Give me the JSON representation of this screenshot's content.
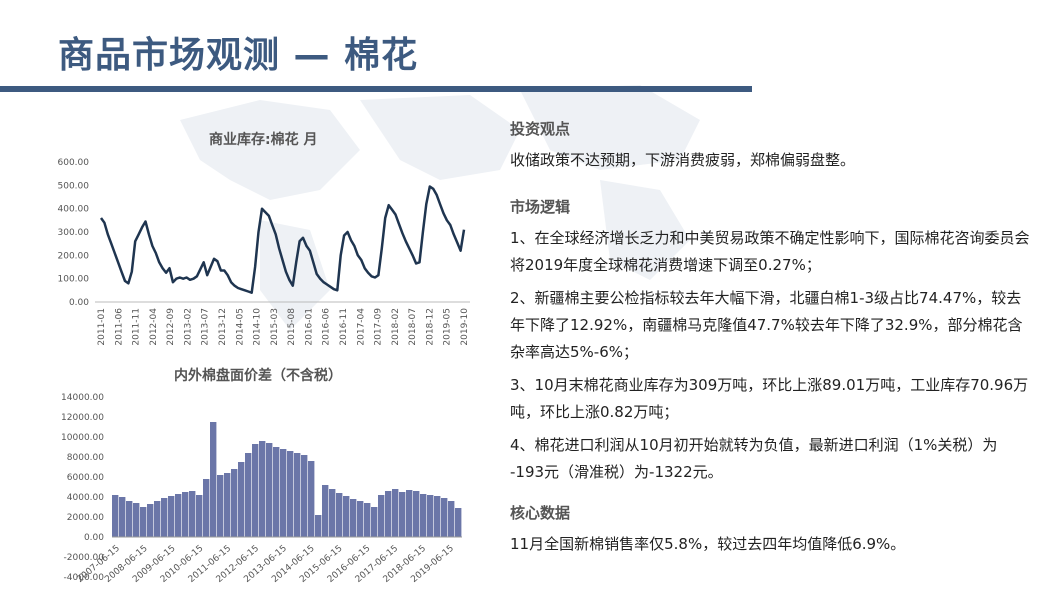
{
  "page": {
    "title": "商品市场观测 — 棉花"
  },
  "chart_data": [
    {
      "type": "line",
      "title": "商业库存:棉花 月",
      "ylim": [
        0,
        600
      ],
      "yticks": [
        "0.00",
        "100.00",
        "200.00",
        "300.00",
        "400.00",
        "500.00",
        "600.00"
      ],
      "xtick_labels": [
        "2011-01",
        "2011-06",
        "2011-11",
        "2012-04",
        "2012-09",
        "2013-02",
        "2013-07",
        "2013-12",
        "2014-05",
        "2014-10",
        "2015-03",
        "2015-08",
        "2016-01",
        "2016-06",
        "2016-11",
        "2017-04",
        "2017-09",
        "2018-02",
        "2018-07",
        "2018-12",
        "2019-05",
        "2019-10"
      ],
      "grid": false,
      "color": "#1f3550",
      "x": [
        "2011-01",
        "2011-02",
        "2011-03",
        "2011-04",
        "2011-05",
        "2011-06",
        "2011-07",
        "2011-08",
        "2011-09",
        "2011-10",
        "2011-11",
        "2011-12",
        "2012-01",
        "2012-02",
        "2012-03",
        "2012-04",
        "2012-05",
        "2012-06",
        "2012-07",
        "2012-08",
        "2012-09",
        "2012-10",
        "2012-11",
        "2012-12",
        "2013-01",
        "2013-02",
        "2013-03",
        "2013-04",
        "2013-05",
        "2013-06",
        "2013-07",
        "2013-08",
        "2013-09",
        "2013-10",
        "2013-11",
        "2013-12",
        "2014-01",
        "2014-02",
        "2014-03",
        "2014-04",
        "2014-05",
        "2014-06",
        "2014-07",
        "2014-08",
        "2014-09",
        "2014-10",
        "2014-11",
        "2014-12",
        "2015-01",
        "2015-02",
        "2015-03",
        "2015-04",
        "2015-05",
        "2015-06",
        "2015-07",
        "2015-08",
        "2015-09",
        "2015-10",
        "2015-11",
        "2015-12",
        "2016-01",
        "2016-02",
        "2016-03",
        "2016-04",
        "2016-05",
        "2016-06",
        "2016-07",
        "2016-08",
        "2016-09",
        "2016-10",
        "2016-11",
        "2016-12",
        "2017-01",
        "2017-02",
        "2017-03",
        "2017-04",
        "2017-05",
        "2017-06",
        "2017-07",
        "2017-08",
        "2017-09",
        "2017-10",
        "2017-11",
        "2017-12",
        "2018-01",
        "2018-02",
        "2018-03",
        "2018-04",
        "2018-05",
        "2018-06",
        "2018-07",
        "2018-08",
        "2018-09",
        "2018-10",
        "2018-11",
        "2018-12",
        "2019-01",
        "2019-02",
        "2019-03",
        "2019-04",
        "2019-05",
        "2019-06",
        "2019-07",
        "2019-08",
        "2019-09",
        "2019-10"
      ],
      "values": [
        360,
        340,
        290,
        250,
        210,
        170,
        130,
        90,
        80,
        130,
        260,
        290,
        320,
        345,
        290,
        240,
        210,
        170,
        145,
        125,
        145,
        85,
        100,
        105,
        100,
        105,
        95,
        100,
        110,
        140,
        170,
        115,
        150,
        185,
        175,
        135,
        135,
        115,
        85,
        70,
        60,
        55,
        50,
        45,
        40,
        150,
        300,
        400,
        385,
        370,
        330,
        290,
        230,
        180,
        130,
        95,
        70,
        170,
        260,
        275,
        240,
        220,
        170,
        120,
        100,
        85,
        75,
        65,
        55,
        50,
        200,
        285,
        300,
        265,
        240,
        200,
        180,
        145,
        125,
        110,
        105,
        115,
        230,
        360,
        415,
        395,
        375,
        335,
        295,
        260,
        230,
        200,
        165,
        170,
        300,
        420,
        495,
        485,
        460,
        420,
        380,
        350,
        330,
        290,
        255,
        220,
        310
      ]
    },
    {
      "type": "bar",
      "title": "内外棉盘面价差（不含税）",
      "ylim": [
        -4000,
        14000
      ],
      "yticks": [
        "-4000.00",
        "-2000.00",
        "0.00",
        "2000.00",
        "4000.00",
        "6000.00",
        "8000.00",
        "10000.00",
        "12000.00",
        "14000.00"
      ],
      "xtick_labels": [
        "2007-06-15",
        "2008-06-15",
        "2009-06-15",
        "2010-06-15",
        "2011-06-15",
        "2012-06-15",
        "2013-06-15",
        "2014-06-15",
        "2015-06-15",
        "2016-06-15",
        "2017-06-15",
        "2018-06-15",
        "2019-06-15"
      ],
      "color": "#6b76a8",
      "x": [
        "2007-06",
        "2007-09",
        "2007-12",
        "2008-03",
        "2008-06",
        "2008-09",
        "2008-12",
        "2009-03",
        "2009-06",
        "2009-09",
        "2009-12",
        "2010-03",
        "2010-06",
        "2010-09",
        "2010-12",
        "2011-03",
        "2011-06",
        "2011-09",
        "2011-12",
        "2012-03",
        "2012-06",
        "2012-09",
        "2012-12",
        "2013-03",
        "2013-06",
        "2013-09",
        "2013-12",
        "2014-03",
        "2014-06",
        "2014-09",
        "2014-12",
        "2015-03",
        "2015-06",
        "2015-09",
        "2015-12",
        "2016-03",
        "2016-06",
        "2016-09",
        "2016-12",
        "2017-03",
        "2017-06",
        "2017-09",
        "2017-12",
        "2018-03",
        "2018-06",
        "2018-09",
        "2018-12",
        "2019-03",
        "2019-06",
        "2019-09"
      ],
      "values": [
        4200,
        4000,
        3600,
        3400,
        3000,
        3300,
        3600,
        3900,
        4100,
        4300,
        4500,
        4600,
        4200,
        5800,
        11500,
        6200,
        6400,
        6800,
        7500,
        8400,
        9300,
        9600,
        9400,
        9000,
        8800,
        8600,
        8400,
        8200,
        7600,
        2200,
        5200,
        4800,
        4400,
        4100,
        3800,
        3600,
        3400,
        3000,
        4200,
        4600,
        4800,
        4500,
        4700,
        4600,
        4300,
        4200,
        4100,
        3900,
        3600,
        2900
      ]
    }
  ],
  "right": {
    "sections": [
      {
        "heading": "投资观点",
        "paragraphs": [
          "收储政策不达预期，下游消费疲弱，郑棉偏弱盘整。"
        ]
      },
      {
        "heading": "市场逻辑",
        "paragraphs": [
          "1、在全球经济增长乏力和中美贸易政策不确定性影响下，国际棉花咨询委员会将2019年度全球棉花消费增速下调至0.27%；",
          "2、新疆棉主要公检指标较去年大幅下滑，北疆白棉1-3级占比74.47%，较去年下降了12.92%，南疆棉马克隆值47.7%较去年下降了32.9%，部分棉花含杂率高达5%-6%；",
          "3、10月末棉花商业库存为309万吨，环比上涨89.01万吨，工业库存70.96万吨，环比上涨0.82万吨；",
          "4、棉花进口利润从10月初开始就转为负值，最新进口利润（1%关税）为 -193元（滑准税）为-1322元。"
        ]
      },
      {
        "heading": "核心数据",
        "paragraphs": [
          "11月全国新棉销售率仅5.8%，较过去四年均值降低6.9%。"
        ]
      }
    ]
  }
}
